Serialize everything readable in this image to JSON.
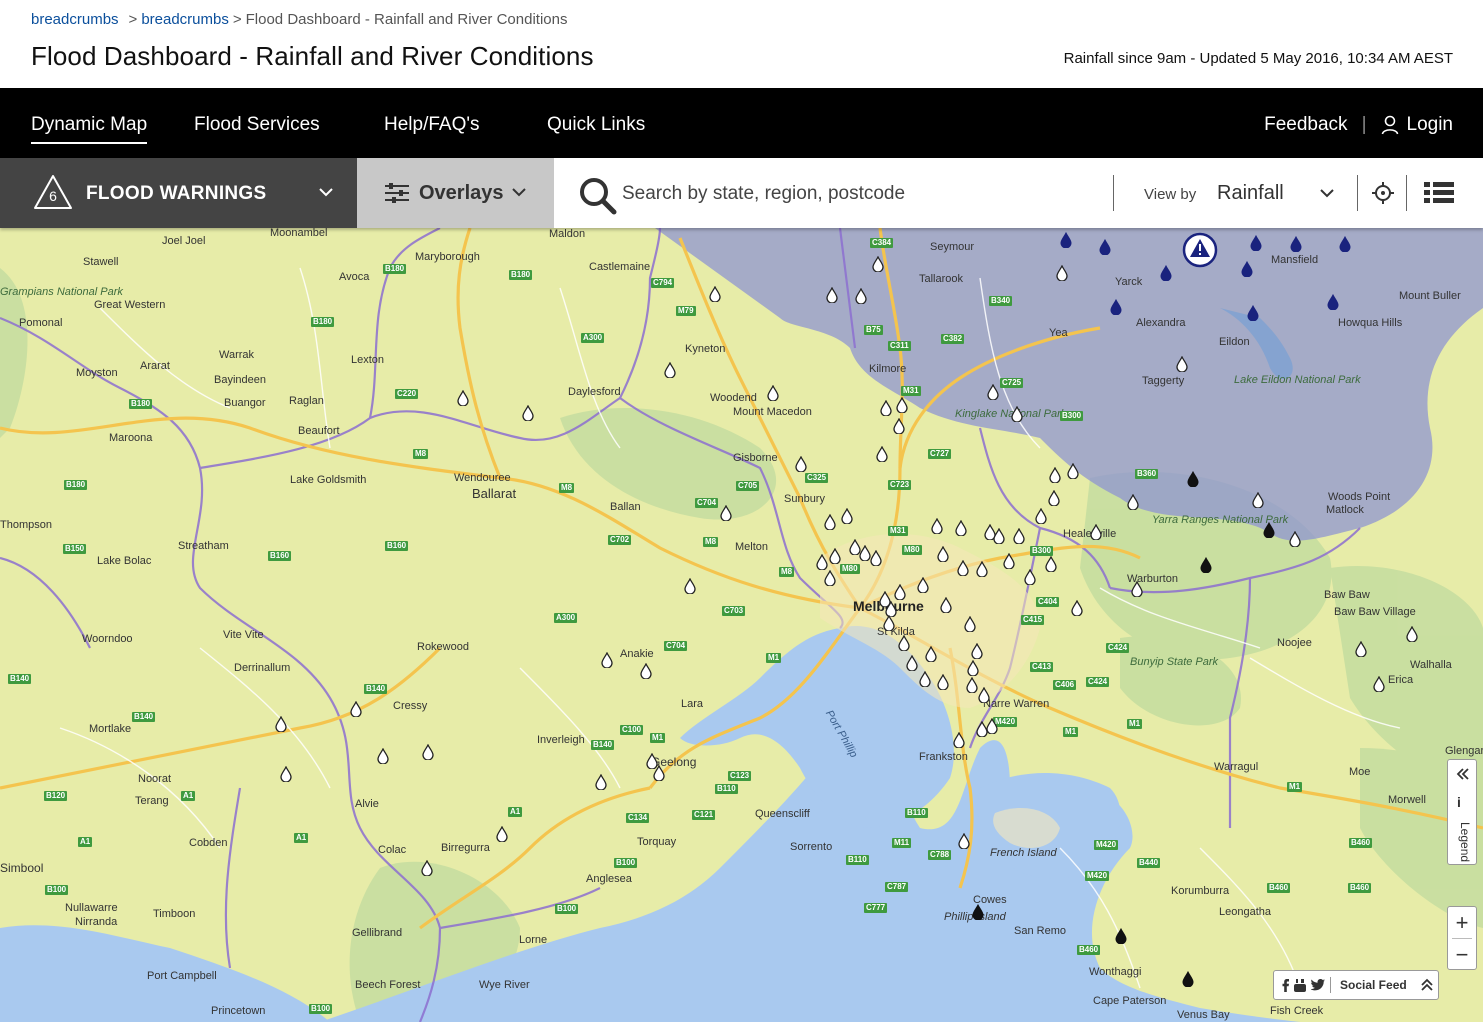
{
  "header": {
    "breadcrumbs": [
      "breadcrumbs",
      "breadcrumbs",
      "Flood Dashboard - Rainfall and River Conditions"
    ],
    "breadcrumb_sep": ">",
    "title": "Flood Dashboard - Rainfall and River Conditions",
    "updated": "Rainfall since 9am - Updated 5 May 2016, 10:34 AM AEST"
  },
  "nav": {
    "items": [
      "Dynamic Map",
      "Flood Services",
      "Help/FAQ's",
      "Quick Links"
    ],
    "active": "Dynamic Map",
    "feedback": "Feedback",
    "divider": "|",
    "login": "Login"
  },
  "toolbar": {
    "flood_warnings_label": "FLOOD WARNINGS",
    "flood_warnings_count": "6",
    "overlays_label": "Overlays",
    "search_placeholder": "Search by state, region, postcode",
    "view_by_label": "View by",
    "view_by_value": "Rainfall"
  },
  "map": {
    "city": "Melbourne",
    "places": [
      "Joel Joel",
      "Moonambel",
      "Stawell",
      "Maryborough",
      "Maldon",
      "Castlemaine",
      "Seymour",
      "Tallarook",
      "Mansfield",
      "Yarck",
      "Avoca",
      "Great Western",
      "Pomonal",
      "Warrak",
      "Lexton",
      "Moyston",
      "Ararat",
      "Bayindeen",
      "Buangor",
      "Raglan",
      "Kyneton",
      "Daylesford",
      "Woodend",
      "Mount Macedon",
      "Kilmore",
      "Yea",
      "Alexandra",
      "Eildon",
      "Taggerty",
      "Howqua Hills",
      "Mount Buller",
      "Maroona",
      "Beaufort",
      "Gisborne",
      "Sunbury",
      "Lake Goldsmith",
      "Wendouree",
      "Ballarat",
      "Ballan",
      "Melton",
      "Healesville",
      "Warburton",
      "Woods Point",
      "Matlock",
      "Streatham",
      "Lake Bolac",
      "Vite Vite",
      "Derrinallum",
      "Rokewood",
      "Anakie",
      "Lara",
      "Geelong",
      "Woorndoo",
      "Mortlake",
      "Cressy",
      "Inverleigh",
      "Noorat",
      "Terang",
      "Alvie",
      "Colac",
      "Birregurra",
      "Cobden",
      "Torquay",
      "Queenscliff",
      "Sorrento",
      "Frankston",
      "Narre Warren",
      "Noojee",
      "Baw Baw",
      "Baw Baw Village",
      "Walhalla",
      "Erica",
      "Warragul",
      "Moe",
      "Morwell",
      "French Island",
      "Cowes",
      "San Remo",
      "Korumburra",
      "Leongatha",
      "Wonthaggi",
      "Cape Paterson",
      "Venus Bay",
      "Fish Creek",
      "Timboon",
      "Nullawarre",
      "Nirranda",
      "Gellibrand",
      "Lorne",
      "Beech Forest",
      "Wye River",
      "Port Campbell",
      "Princetown",
      "Anglesea",
      "St Kilda",
      "Glengar",
      "Mortlake",
      "Thompson",
      "Phillip Island",
      "Simbool",
      "Grampians National Park"
    ],
    "parks": [
      "Kinglake National Park",
      "Yarra Ranges National Park",
      "Lake Eildon National Park",
      "Bunyip State Park"
    ],
    "water": [
      "Port Phillip"
    ],
    "colors": {
      "land": "#e7eca8",
      "forest": "#c6dea0",
      "water": "#a9c9ef",
      "warning_area": "#8c92d2",
      "boundary": "#8c6fd0",
      "highway": "#f4c44e",
      "road_badge": "#3f9a3f"
    }
  },
  "controls": {
    "legend": "Legend",
    "zoom_in": "+",
    "zoom_out": "−",
    "social_feed": "Social Feed"
  }
}
